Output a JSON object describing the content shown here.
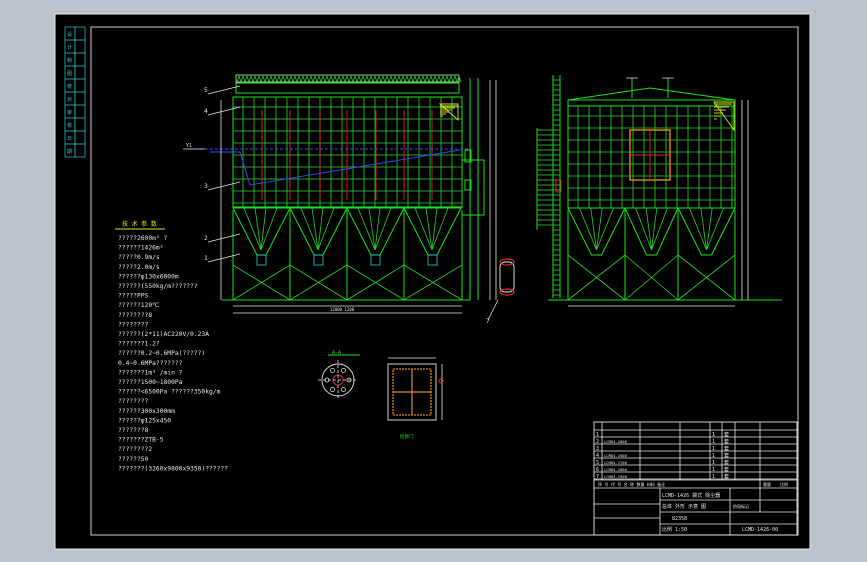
{
  "colors": {
    "workspace": "#bcc3cf",
    "drawing_bg": "#000000",
    "border": "#e8e8e8",
    "green": "#19e619",
    "red": "#e02a2a",
    "yellow": "#e6e62a",
    "blue": "#3a4cff",
    "orange": "#e08a1a",
    "cyan": "#25d3d3"
  },
  "side_labels": [
    "设",
    "计",
    "制",
    "图",
    "校",
    "对",
    "审",
    "核",
    "日",
    "期"
  ],
  "spec": {
    "title": "技 术 参 数",
    "rows": [
      "?????2600m³    ?",
      "??????1426m²",
      "?????0.9m/s",
      "?????2.0m/s",
      "??????φ130x6000m",
      "??????(550kg/m???????",
      "?????PPS",
      "??????120℃",
      "????????8",
      "????????",
      "??????(2*11)AC220V/0.23A",
      "???????1.2?",
      "??????0.2~0.6MPa(?????)",
      "            0.4~0.6MPa???????",
      "???????1m³    /min ?",
      "??????1500~1800Pa",
      "??????<6500Pa  ??????350kg/m",
      "????????",
      "??????300x300mm",
      "??????φ125x450",
      "???????8",
      "???????ZTB-5",
      "????????2",
      "??????50",
      "???????(3260x9800x9350)??????"
    ]
  },
  "front_view": {
    "callouts": [
      "5",
      "4",
      "3",
      "2",
      "1"
    ],
    "bottom_callout": "7",
    "level_mark": "Y1"
  },
  "detail_labels": {
    "flange": "A-A",
    "door": "检修门"
  },
  "title_block": {
    "bom_header": "序 号   代  号      名  称     数量  材料  备注",
    "bom_rows": [
      {
        "no": "1",
        "code": "",
        "name": "",
        "qty": "1",
        "mat": "套"
      },
      {
        "no": "2",
        "code": "LCMD4-2000",
        "name": "",
        "qty": "1",
        "mat": "套"
      },
      {
        "no": "3",
        "code": "",
        "name": "",
        "qty": "1",
        "mat": "套"
      },
      {
        "no": "4",
        "code": "LCMD4-1900",
        "name": "",
        "qty": "1",
        "mat": "套"
      },
      {
        "no": "5",
        "code": "LCMD4-1700",
        "name": "",
        "qty": "1",
        "mat": "套"
      },
      {
        "no": "6",
        "code": "LCMD4-1800",
        "name": "",
        "qty": "1",
        "mat": "套"
      },
      {
        "no": "7",
        "code": "LCMD4-1900",
        "name": "",
        "qty": "1",
        "mat": "套"
      }
    ],
    "project": "LCMD-1426 袋式 除尘器",
    "drawing_name": "总体 外形 示意 图",
    "drawing_no": "82358",
    "scale_text": "比例 1:50",
    "code": "LCMD-1426-00",
    "stage": "阶段标记",
    "weight": "重量",
    "ratio": "比例"
  }
}
